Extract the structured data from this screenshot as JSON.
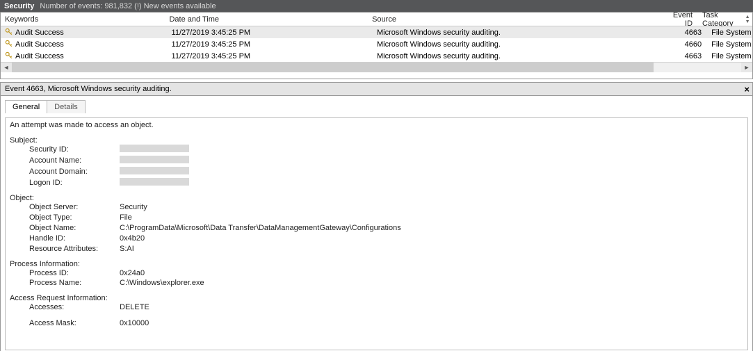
{
  "titlebar": {
    "section": "Security",
    "rest": "Number of events: 981,832 (!) New events available"
  },
  "columns": {
    "keywords": "Keywords",
    "datetime": "Date and Time",
    "source": "Source",
    "eventid": "Event ID",
    "taskcat": "Task Category"
  },
  "rows": [
    {
      "keywords": "Audit Success",
      "datetime": "11/27/2019 3:45:25 PM",
      "source": "Microsoft Windows security auditing.",
      "eventid": "4663",
      "taskcat": "File System",
      "selected": true
    },
    {
      "keywords": "Audit Success",
      "datetime": "11/27/2019 3:45:25 PM",
      "source": "Microsoft Windows security auditing.",
      "eventid": "4660",
      "taskcat": "File System",
      "selected": false
    },
    {
      "keywords": "Audit Success",
      "datetime": "11/27/2019 3:45:25 PM",
      "source": "Microsoft Windows security auditing.",
      "eventid": "4663",
      "taskcat": "File System",
      "selected": false
    }
  ],
  "detail": {
    "header": "Event 4663, Microsoft Windows security auditing.",
    "tabs": {
      "general": "General",
      "details": "Details"
    },
    "headline": "An attempt was made to access an object.",
    "sections": {
      "subject": {
        "title": "Subject:",
        "security_id_label": "Security ID:",
        "account_name_label": "Account Name:",
        "account_domain_label": "Account Domain:",
        "logon_id_label": "Logon ID:"
      },
      "object": {
        "title": "Object:",
        "object_server_label": "Object Server:",
        "object_server_value": "Security",
        "object_type_label": "Object Type:",
        "object_type_value": "File",
        "object_name_label": "Object Name:",
        "object_name_value": "C:\\ProgramData\\Microsoft\\Data Transfer\\DataManagementGateway\\Configurations",
        "handle_id_label": "Handle ID:",
        "handle_id_value": "0x4b20",
        "resource_attr_label": "Resource Attributes:",
        "resource_attr_value": "S:AI"
      },
      "process": {
        "title": "Process Information:",
        "process_id_label": "Process ID:",
        "process_id_value": "0x24a0",
        "process_name_label": "Process Name:",
        "process_name_value": "C:\\Windows\\explorer.exe"
      },
      "access": {
        "title": "Access Request Information:",
        "accesses_label": "Accesses:",
        "accesses_value": "DELETE",
        "access_mask_label": "Access Mask:",
        "access_mask_value": "0x10000"
      }
    }
  }
}
